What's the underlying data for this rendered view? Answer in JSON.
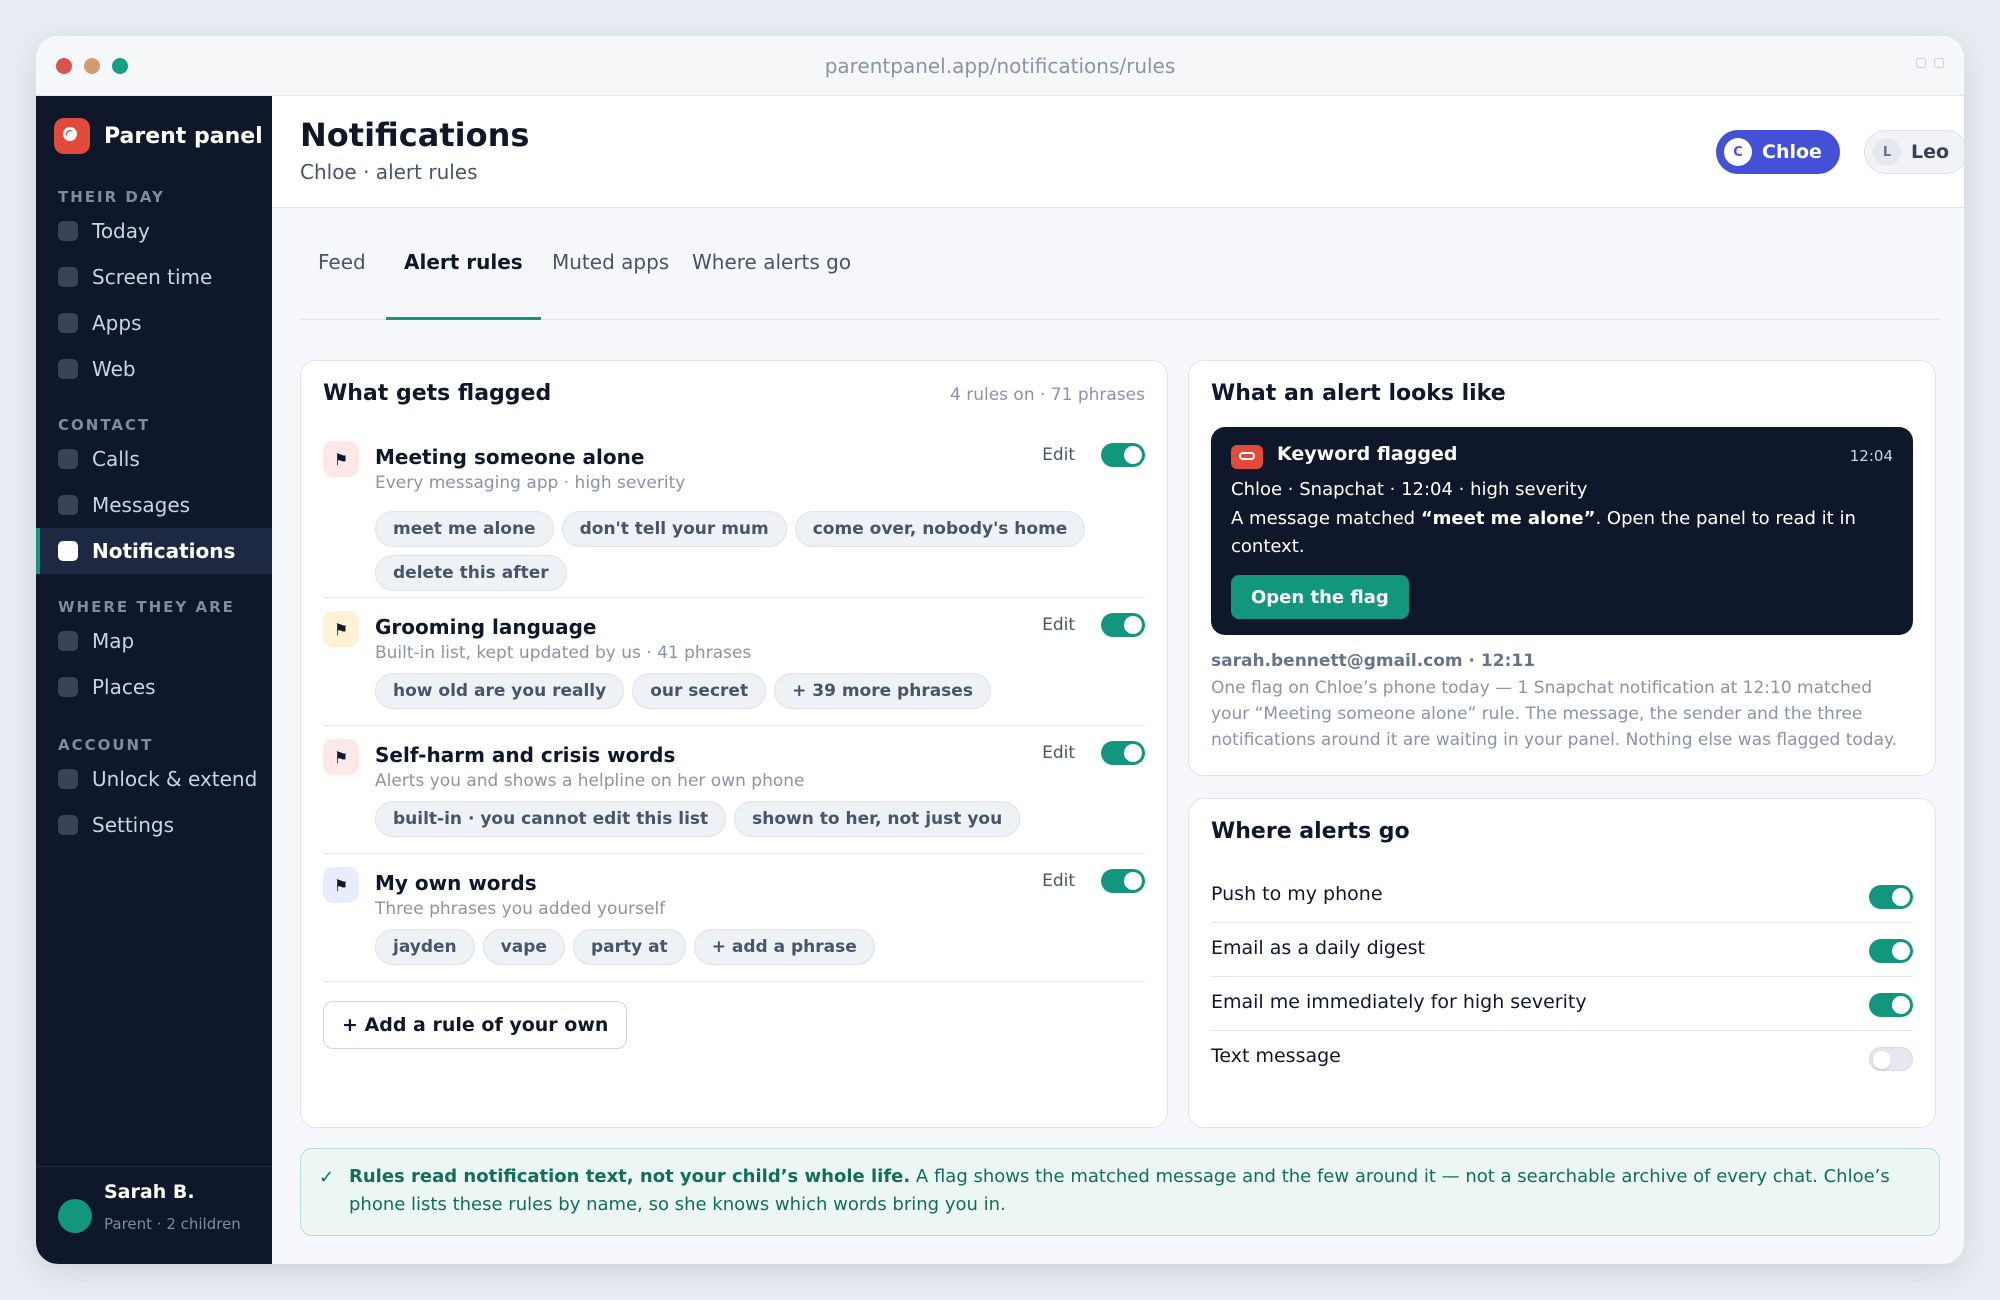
{
  "window": {
    "url": "parentpanel.app/notifications/rules"
  },
  "sidebar": {
    "brand": "Parent panel",
    "sections": [
      {
        "label": "THEIR DAY",
        "items": [
          "Today",
          "Screen time",
          "Apps",
          "Web"
        ]
      },
      {
        "label": "CONTACT",
        "items": [
          "Calls",
          "Messages",
          "Notifications"
        ]
      },
      {
        "label": "WHERE THEY ARE",
        "items": [
          "Map",
          "Places"
        ]
      },
      {
        "label": "ACCOUNT",
        "items": [
          "Unlock & extend",
          "Settings"
        ]
      }
    ],
    "active": "Notifications",
    "user": {
      "name": "Sarah B.",
      "subtitle": "Parent · 2 children"
    }
  },
  "header": {
    "title": "Notifications",
    "subtitle": "Chloe · alert rules",
    "children": [
      {
        "initial": "C",
        "name": "Chloe",
        "selected": true
      },
      {
        "initial": "L",
        "name": "Leo",
        "selected": false
      }
    ]
  },
  "tabs": [
    "Feed",
    "Alert rules",
    "Muted apps",
    "Where alerts go"
  ],
  "active_tab": "Alert rules",
  "rules_card": {
    "title": "What gets flagged",
    "meta": "4 rules on · 71 phrases",
    "edit_label": "Edit",
    "rules": [
      {
        "title": "Meeting someone alone",
        "desc": "Every messaging app · high severity",
        "enabled": true,
        "chips": [
          "meet me alone",
          "don't tell your mum",
          "come over, nobody's home",
          "delete this after"
        ]
      },
      {
        "title": "Grooming language",
        "desc": "Built-in list, kept updated by us · 41 phrases",
        "enabled": true,
        "chips": [
          "how old are you really",
          "our secret",
          "+ 39 more phrases"
        ]
      },
      {
        "title": "Self-harm and crisis words",
        "desc": "Alerts you and shows a helpline on her own phone",
        "enabled": true,
        "chips": [
          "built-in · you cannot edit this list",
          "shown to her, not just you"
        ]
      },
      {
        "title": "My own words",
        "desc": "Three phrases you added yourself",
        "enabled": true,
        "chips": [
          "jayden",
          "vape",
          "party at",
          "+ add a phrase"
        ]
      }
    ],
    "add_button": "+ Add a rule of your own"
  },
  "preview_card": {
    "title": "What an alert looks like",
    "alert": {
      "title": "Keyword flagged",
      "time": "12:04",
      "meta": "Chloe · Snapchat · 12:04 · high severity",
      "text_before": "A message matched ",
      "text_match": "“meet me alone”",
      "text_after": ". Open the panel to read it in context.",
      "button": "Open the flag"
    },
    "email_from": "sarah.bennett@gmail.com · 12:11",
    "email_body": "One flag on Chloe’s phone today — 1 Snapchat notification at 12:10 matched your “Meeting someone alone” rule. The message, the sender and the three notifications around it are waiting in your panel. Nothing else was flagged today."
  },
  "destinations_card": {
    "title": "Where alerts go",
    "items": [
      {
        "label": "Push to my phone",
        "enabled": true
      },
      {
        "label": "Email as a daily digest",
        "enabled": true
      },
      {
        "label": "Email me immediately for high severity",
        "enabled": true
      },
      {
        "label": "Text message",
        "enabled": false
      }
    ]
  },
  "banner": {
    "bold": "Rules read notification text, not your child’s whole life.",
    "text": " A flag shows the matched message and the few around it — not a searchable archive of every chat. Chloe’s phone lists these rules by name, so she knows which words bring you in."
  },
  "colors": {
    "accent": "#12977e",
    "sidebar": "#0f172a",
    "selected_child": "#4451d6",
    "brand": "#e24a3b"
  }
}
